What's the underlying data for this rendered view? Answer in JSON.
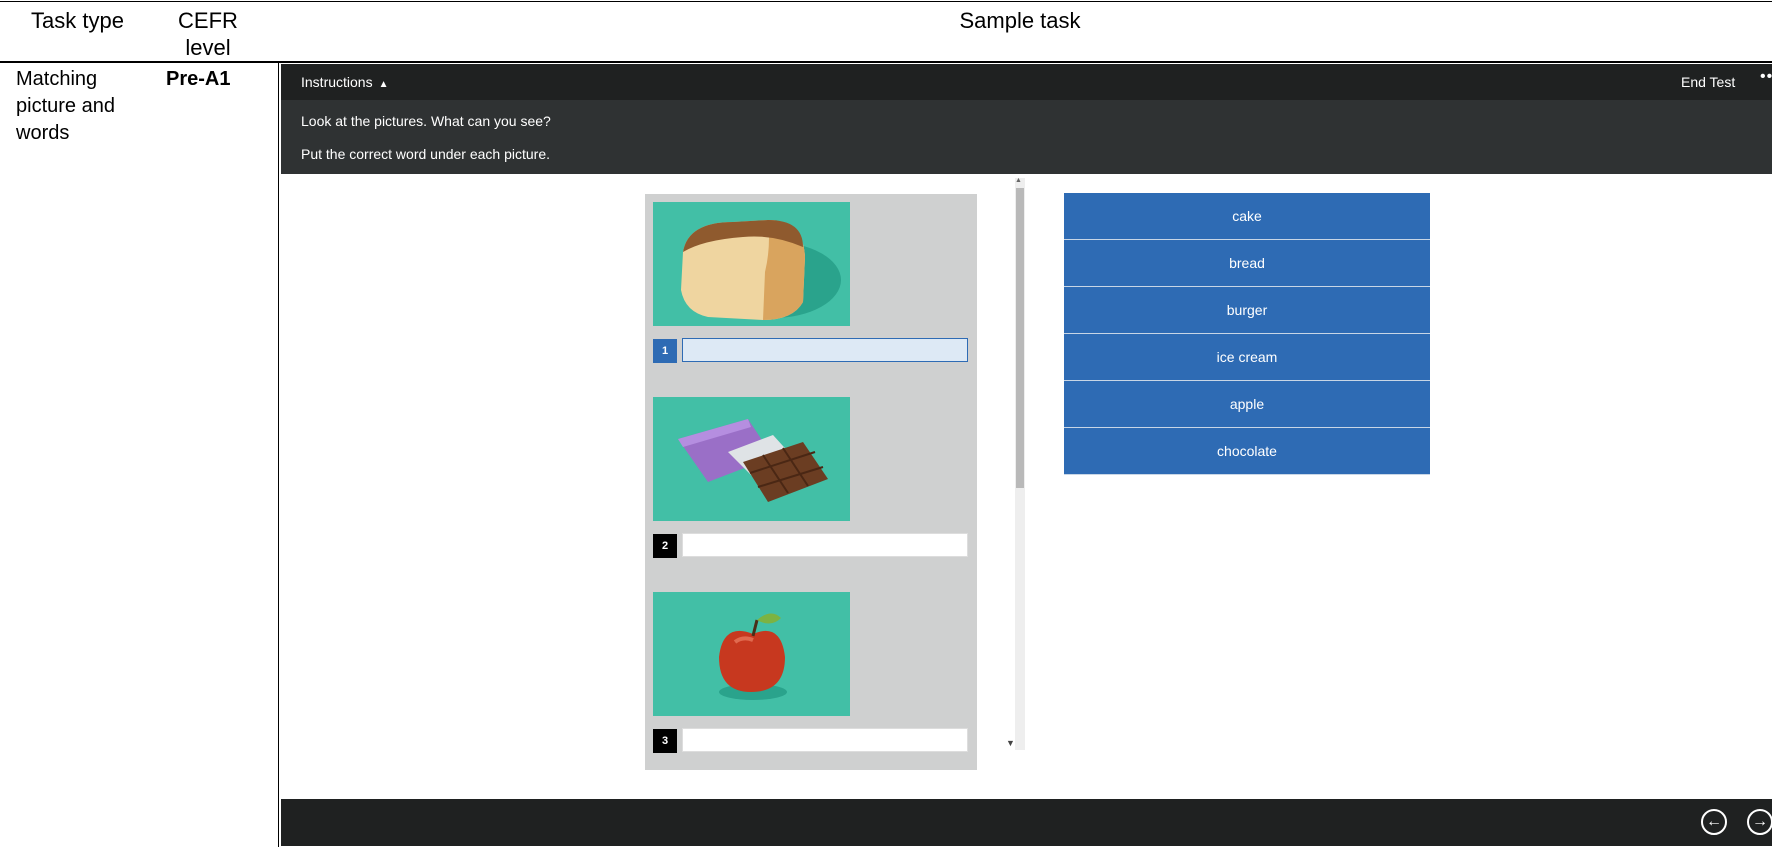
{
  "table": {
    "headers": [
      "Task type",
      "CEFR level",
      "Sample task"
    ],
    "row": {
      "task_type": "Matching picture and words",
      "cefr_level": "Pre-A1"
    }
  },
  "app": {
    "topbar": {
      "instructions_label": "Instructions",
      "end_test_label": "End Test",
      "more_label": "•••"
    },
    "instructions": [
      "Look at the pictures. What can you see?",
      "Put the correct word under each picture."
    ],
    "items": [
      {
        "number": "1",
        "picture": "bread-picture",
        "answer": "",
        "active": true
      },
      {
        "number": "2",
        "picture": "chocolate-picture",
        "answer": "",
        "active": false
      },
      {
        "number": "3",
        "picture": "apple-picture",
        "answer": "",
        "active": false
      }
    ],
    "word_bank": [
      "cake",
      "bread",
      "burger",
      "ice cream",
      "apple",
      "chocolate"
    ],
    "nav": {
      "prev_icon": "arrow-left-circle-icon",
      "next_icon": "arrow-right-circle-icon"
    },
    "colors": {
      "accent": "#2e6bb4",
      "bar": "#1f2121",
      "panel": "#2f3233",
      "picture_bg": "#42bfa6"
    }
  }
}
